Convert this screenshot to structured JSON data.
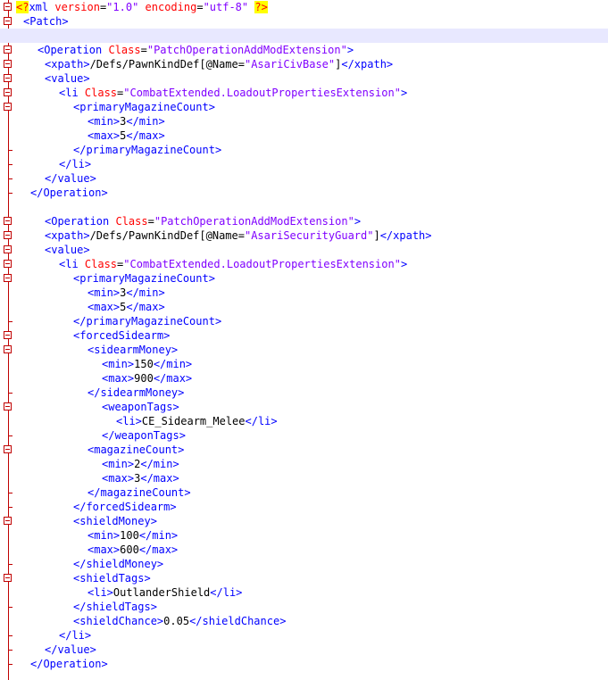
{
  "lines": [
    {
      "indent": 0,
      "fold": true,
      "parts": [
        [
          "pi-hl",
          "<?"
        ],
        [
          "b",
          "xml "
        ],
        [
          "a",
          "version"
        ],
        [
          "t",
          "="
        ],
        [
          "v",
          "\"1.0\""
        ],
        [
          "t",
          " "
        ],
        [
          "a",
          "encoding"
        ],
        [
          "t",
          "="
        ],
        [
          "v",
          "\"utf-8\""
        ],
        [
          "t",
          " "
        ],
        [
          "pi-hl",
          "?>"
        ]
      ]
    },
    {
      "indent": 1,
      "fold": true,
      "parts": [
        [
          "b",
          "<Patch>"
        ]
      ]
    },
    {
      "indent": 0,
      "highlight": true,
      "parts": []
    },
    {
      "indent": 3,
      "fold": true,
      "parts": [
        [
          "b",
          "<Operation "
        ],
        [
          "a",
          "Class"
        ],
        [
          "t",
          "="
        ],
        [
          "v",
          "\"PatchOperationAddModExtension\""
        ],
        [
          "b",
          ">"
        ]
      ]
    },
    {
      "indent": 4,
      "fold": true,
      "parts": [
        [
          "b",
          "<xpath>"
        ],
        [
          "t",
          "/Defs/PawnKindDef[@Name="
        ],
        [
          "v",
          "\"AsariCivBase\""
        ],
        [
          "t",
          "]"
        ],
        [
          "b",
          "</xpath>"
        ]
      ]
    },
    {
      "indent": 4,
      "fold": true,
      "parts": [
        [
          "b",
          "<value>"
        ]
      ]
    },
    {
      "indent": 6,
      "fold": true,
      "parts": [
        [
          "b",
          "<li "
        ],
        [
          "a",
          "Class"
        ],
        [
          "t",
          "="
        ],
        [
          "v",
          "\"CombatExtended.LoadoutPropertiesExtension\""
        ],
        [
          "b",
          ">"
        ]
      ]
    },
    {
      "indent": 8,
      "fold": true,
      "parts": [
        [
          "b",
          "<primaryMagazineCount>"
        ]
      ]
    },
    {
      "indent": 10,
      "parts": [
        [
          "b",
          "<min>"
        ],
        [
          "t",
          "3"
        ],
        [
          "b",
          "</min>"
        ]
      ]
    },
    {
      "indent": 10,
      "parts": [
        [
          "b",
          "<max>"
        ],
        [
          "t",
          "5"
        ],
        [
          "b",
          "</max>"
        ]
      ]
    },
    {
      "indent": 8,
      "end": true,
      "parts": [
        [
          "b",
          "</primaryMagazineCount>"
        ]
      ]
    },
    {
      "indent": 6,
      "end": true,
      "parts": [
        [
          "b",
          "</li>"
        ]
      ]
    },
    {
      "indent": 4,
      "end": true,
      "parts": [
        [
          "b",
          "</value>"
        ]
      ]
    },
    {
      "indent": 2,
      "end": true,
      "parts": [
        [
          "b",
          "</Operation>"
        ]
      ]
    },
    {
      "indent": 0,
      "parts": []
    },
    {
      "indent": 4,
      "fold": true,
      "parts": [
        [
          "b",
          "<Operation "
        ],
        [
          "a",
          "Class"
        ],
        [
          "t",
          "="
        ],
        [
          "v",
          "\"PatchOperationAddModExtension\""
        ],
        [
          "b",
          ">"
        ]
      ]
    },
    {
      "indent": 4,
      "fold": true,
      "parts": [
        [
          "b",
          "<xpath>"
        ],
        [
          "t",
          "/Defs/PawnKindDef[@Name="
        ],
        [
          "v",
          "\"AsariSecurityGuard\""
        ],
        [
          "t",
          "]"
        ],
        [
          "b",
          "</xpath>"
        ]
      ]
    },
    {
      "indent": 4,
      "fold": true,
      "parts": [
        [
          "b",
          "<value>"
        ]
      ]
    },
    {
      "indent": 6,
      "fold": true,
      "parts": [
        [
          "b",
          "<li "
        ],
        [
          "a",
          "Class"
        ],
        [
          "t",
          "="
        ],
        [
          "v",
          "\"CombatExtended.LoadoutPropertiesExtension\""
        ],
        [
          "b",
          ">"
        ]
      ]
    },
    {
      "indent": 8,
      "fold": true,
      "parts": [
        [
          "b",
          "<primaryMagazineCount>"
        ]
      ]
    },
    {
      "indent": 10,
      "parts": [
        [
          "b",
          "<min>"
        ],
        [
          "t",
          "3"
        ],
        [
          "b",
          "</min>"
        ]
      ]
    },
    {
      "indent": 10,
      "parts": [
        [
          "b",
          "<max>"
        ],
        [
          "t",
          "5"
        ],
        [
          "b",
          "</max>"
        ]
      ]
    },
    {
      "indent": 8,
      "end": true,
      "parts": [
        [
          "b",
          "</primaryMagazineCount>"
        ]
      ]
    },
    {
      "indent": 8,
      "fold": true,
      "parts": [
        [
          "b",
          "<forcedSidearm>"
        ]
      ]
    },
    {
      "indent": 10,
      "fold": true,
      "parts": [
        [
          "b",
          "<sidearmMoney>"
        ]
      ]
    },
    {
      "indent": 12,
      "parts": [
        [
          "b",
          "<min>"
        ],
        [
          "t",
          "150"
        ],
        [
          "b",
          "</min>"
        ]
      ]
    },
    {
      "indent": 12,
      "parts": [
        [
          "b",
          "<max>"
        ],
        [
          "t",
          "900"
        ],
        [
          "b",
          "</max>"
        ]
      ]
    },
    {
      "indent": 10,
      "end": true,
      "parts": [
        [
          "b",
          "</sidearmMoney>"
        ]
      ]
    },
    {
      "indent": 12,
      "fold": true,
      "parts": [
        [
          "b",
          "<weaponTags>"
        ]
      ]
    },
    {
      "indent": 14,
      "parts": [
        [
          "b",
          "<li>"
        ],
        [
          "t",
          "CE_Sidearm_Melee"
        ],
        [
          "b",
          "</li>"
        ]
      ]
    },
    {
      "indent": 12,
      "end": true,
      "parts": [
        [
          "b",
          "</weaponTags>"
        ]
      ]
    },
    {
      "indent": 10,
      "fold": true,
      "parts": [
        [
          "b",
          "<magazineCount>"
        ]
      ]
    },
    {
      "indent": 12,
      "parts": [
        [
          "b",
          "<min>"
        ],
        [
          "t",
          "2"
        ],
        [
          "b",
          "</min>"
        ]
      ]
    },
    {
      "indent": 12,
      "parts": [
        [
          "b",
          "<max>"
        ],
        [
          "t",
          "3"
        ],
        [
          "b",
          "</max>"
        ]
      ]
    },
    {
      "indent": 10,
      "end": true,
      "parts": [
        [
          "b",
          "</magazineCount>"
        ]
      ]
    },
    {
      "indent": 8,
      "end": true,
      "parts": [
        [
          "b",
          "</forcedSidearm>"
        ]
      ]
    },
    {
      "indent": 8,
      "fold": true,
      "parts": [
        [
          "b",
          "<shieldMoney>"
        ]
      ]
    },
    {
      "indent": 10,
      "parts": [
        [
          "b",
          "<min>"
        ],
        [
          "t",
          "100"
        ],
        [
          "b",
          "</min>"
        ]
      ]
    },
    {
      "indent": 10,
      "parts": [
        [
          "b",
          "<max>"
        ],
        [
          "t",
          "600"
        ],
        [
          "b",
          "</max>"
        ]
      ]
    },
    {
      "indent": 8,
      "end": true,
      "parts": [
        [
          "b",
          "</shieldMoney>"
        ]
      ]
    },
    {
      "indent": 8,
      "fold": true,
      "parts": [
        [
          "b",
          "<shieldTags>"
        ]
      ]
    },
    {
      "indent": 10,
      "parts": [
        [
          "b",
          "<li>"
        ],
        [
          "t",
          "OutlanderShield"
        ],
        [
          "b",
          "</li>"
        ]
      ]
    },
    {
      "indent": 8,
      "end": true,
      "parts": [
        [
          "b",
          "</shieldTags>"
        ]
      ]
    },
    {
      "indent": 8,
      "parts": [
        [
          "b",
          "<shieldChance>"
        ],
        [
          "t",
          "0.05"
        ],
        [
          "b",
          "</shieldChance>"
        ]
      ]
    },
    {
      "indent": 6,
      "end": true,
      "parts": [
        [
          "b",
          "</li>"
        ]
      ]
    },
    {
      "indent": 4,
      "end": true,
      "parts": [
        [
          "b",
          "</value>"
        ]
      ]
    },
    {
      "indent": 2,
      "end": true,
      "parts": [
        [
          "b",
          "</Operation>"
        ]
      ]
    }
  ]
}
